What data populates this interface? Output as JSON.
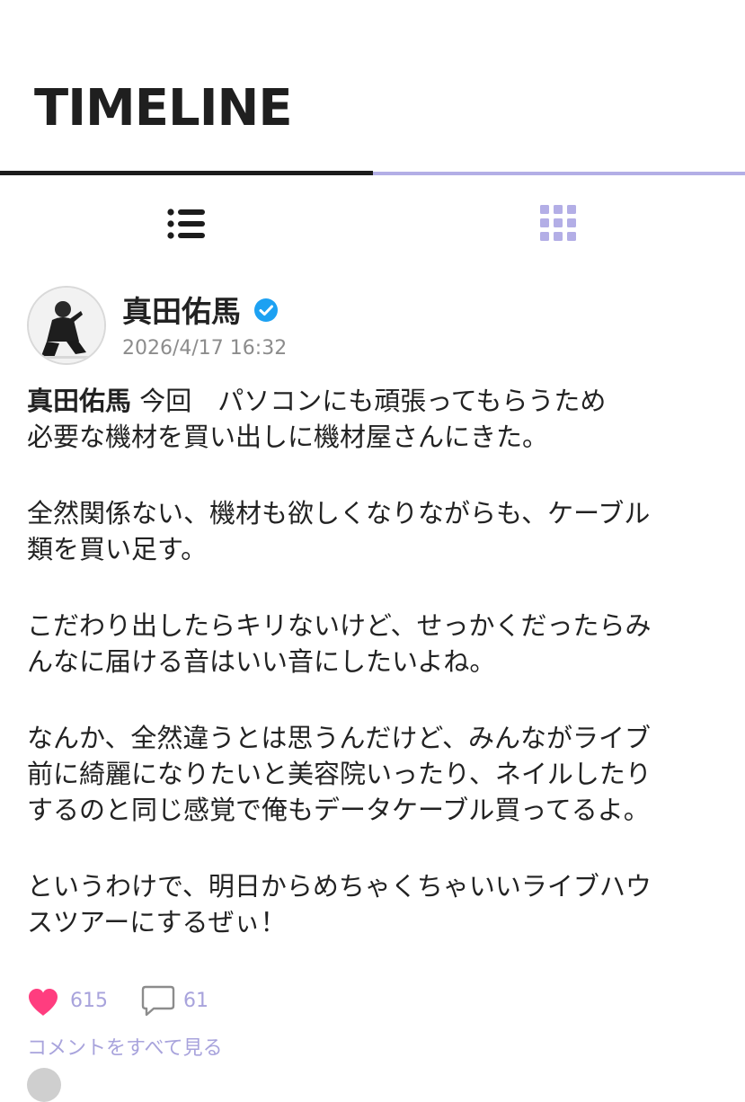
{
  "header": {
    "title": "TIMELINE"
  },
  "tabs": [
    {
      "icon": "list-view-icon",
      "active": true
    },
    {
      "icon": "grid-view-icon",
      "active": false
    }
  ],
  "colors": {
    "accent": "#b3aee6",
    "link": "#a8a3dc",
    "like": "#ff3d7f",
    "verified": "#1da1f2",
    "timestamp": "#8c8c8c"
  },
  "post": {
    "author": "真田佑馬",
    "timestamp": "2026/4/17 16:32",
    "body": {
      "author_inline": "真田佑馬",
      "p1_line1": " 今回　パソコンにも頑張ってもらうため",
      "p1_line2": "必要な機材を買い出しに機材屋さんにきた。",
      "p2_line1": "全然関係ない、機材も欲しくなりながらも、ケーブル",
      "p2_line2": "類を買い足す。",
      "p3_line1": "こだわり出したらキリないけど、せっかくだったらみ",
      "p3_line2": "んなに届ける音はいい音にしたいよね。",
      "p4_line1": "なんか、全然違うとは思うんだけど、みんながライブ",
      "p4_line2": "前に綺麗になりたいと美容院いったり、ネイルしたり",
      "p4_line3": "するのと同じ感覚で俺もデータケーブル買ってるよ。",
      "p5_line1": "というわけで、明日からめちゃくちゃいいライブハウ",
      "p5_line2": "スツアーにするぜぃ！"
    },
    "likes": "615",
    "comments": "61",
    "view_all_comments": "コメントをすべて見る"
  }
}
